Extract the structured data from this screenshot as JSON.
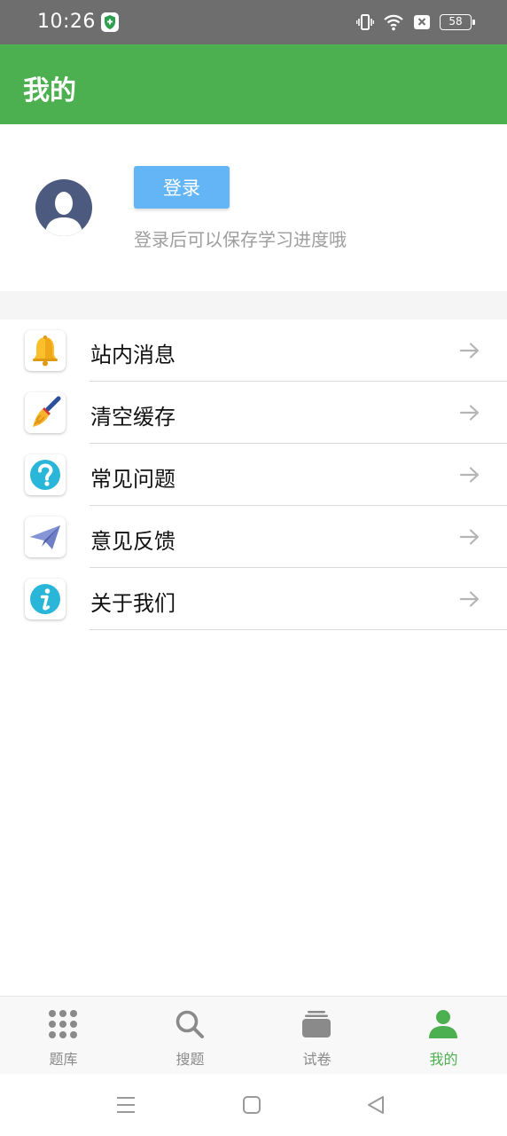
{
  "status_bar": {
    "time": "10:26",
    "battery": "58"
  },
  "app_bar": {
    "title": "我的"
  },
  "profile": {
    "login_label": "登录",
    "hint": "登录后可以保存学习进度哦"
  },
  "menu": {
    "items": [
      {
        "label": "站内消息",
        "icon": "bell-icon"
      },
      {
        "label": "清空缓存",
        "icon": "broom-icon"
      },
      {
        "label": "常见问题",
        "icon": "question-icon"
      },
      {
        "label": "意见反馈",
        "icon": "paper-plane-icon"
      },
      {
        "label": "关于我们",
        "icon": "info-icon"
      }
    ]
  },
  "bottom_nav": {
    "items": [
      {
        "label": "题库",
        "icon": "grid-dots-icon"
      },
      {
        "label": "搜题",
        "icon": "search-icon"
      },
      {
        "label": "试卷",
        "icon": "paper-stack-icon"
      },
      {
        "label": "我的",
        "icon": "person-icon",
        "active": true
      }
    ]
  },
  "colors": {
    "primary": "#4caf50",
    "login_button": "#64b5f6",
    "avatar": "#4c5a7f"
  }
}
